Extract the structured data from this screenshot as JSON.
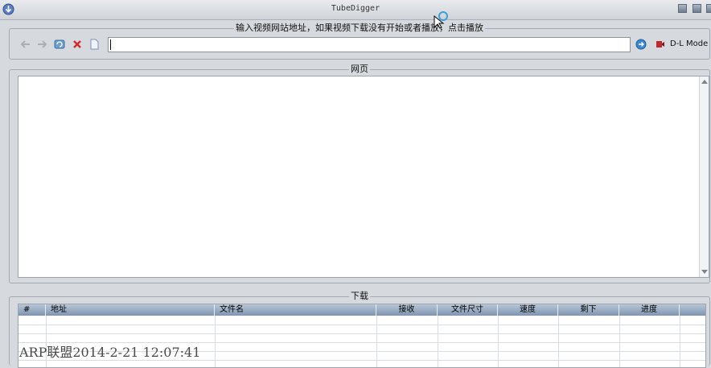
{
  "window": {
    "title": "TubeDigger",
    "app_icon": "download-arrow-icon",
    "buttons": [
      "minimize-icon",
      "maximize-icon",
      "close-icon"
    ]
  },
  "url_bar": {
    "label": "输入视频网站地址，如果视频下载没有开始或者播放，点击播放",
    "value": "",
    "toolbar_icons": [
      "back-arrow-icon",
      "forward-arrow-icon",
      "refresh-icon",
      "stop-icon",
      "page-icon"
    ],
    "go_icon": "go-icon",
    "mode_icon": "record-icon",
    "mode_label": "D-L Mode"
  },
  "page_panel": {
    "label": "网页"
  },
  "download_panel": {
    "label": "下载",
    "columns": [
      "#",
      "地址",
      "文件名",
      "接收",
      "文件尺寸",
      "速度",
      "剩下",
      "进度"
    ],
    "rows": []
  },
  "watermark": "ARP联盟2014-2-21 12:07:41",
  "colors": {
    "background": "#d6d9dd",
    "header_blue": "#8ea3bb"
  }
}
